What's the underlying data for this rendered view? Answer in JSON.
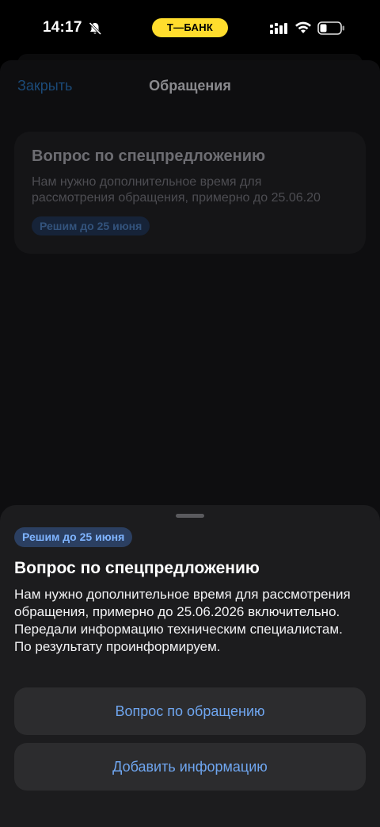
{
  "status_bar": {
    "time": "14:17",
    "bank_name": "Т—БАНК",
    "icons": [
      "bell-slash-icon",
      "signal-icon",
      "wifi-icon",
      "battery-icon"
    ]
  },
  "background": {
    "nav": {
      "close_label": "Закрыть",
      "title": "Обращения"
    },
    "card": {
      "title": "Вопрос по спецпредложению",
      "text_line1": "Нам нужно дополнительное время для",
      "text_line2": "рассмотрения обращения, примерно до 25.06.20",
      "badge": "Решим до 25 июня"
    }
  },
  "sheet": {
    "badge": "Решим до 25 июня",
    "title": "Вопрос по спецпредложению",
    "text": "Нам нужно дополнительное время для рассмотрения обращения, примерно до 25.06.2026 включительно. Передали информацию техническим специалистам. По результату проинформируем.",
    "buttons": {
      "question_label": "Вопрос по обращению",
      "add_info_label": "Добавить информацию"
    }
  },
  "colors": {
    "bank_yellow": "#FFDD2D",
    "accent_blue": "#6FA6F0",
    "sheet_bg": "#1C1C1E",
    "button_bg": "#2C2C2E"
  }
}
